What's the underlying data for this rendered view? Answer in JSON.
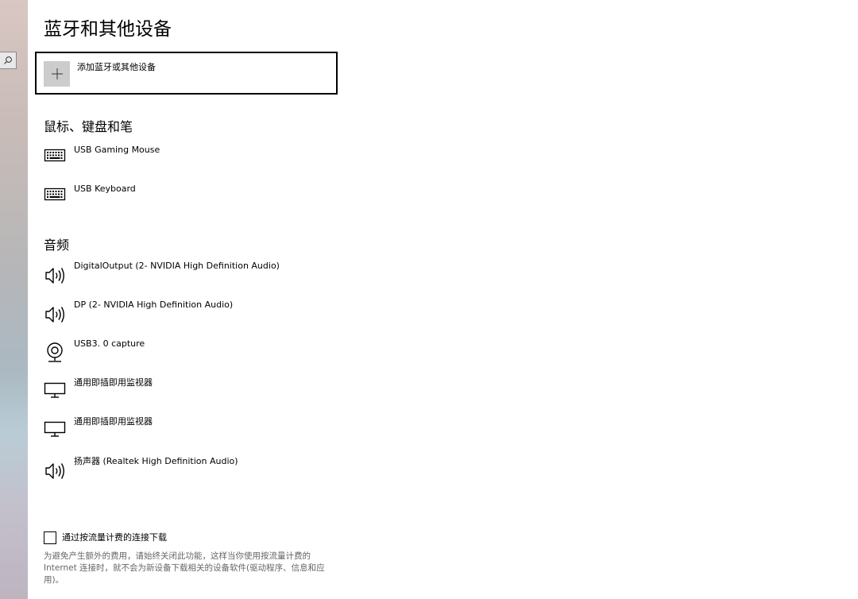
{
  "page": {
    "title": "蓝牙和其他设备"
  },
  "add_device": {
    "label": "添加蓝牙或其他设备",
    "icon": "plus-icon"
  },
  "sections": {
    "input": {
      "heading": "鼠标、键盘和笔",
      "devices": [
        {
          "name": "USB Gaming Mouse",
          "icon": "keyboard-icon"
        },
        {
          "name": "USB Keyboard",
          "icon": "keyboard-icon"
        }
      ]
    },
    "audio": {
      "heading": "音频",
      "devices": [
        {
          "name": "DigitalOutput (2- NVIDIA High Definition Audio)",
          "icon": "speaker-icon"
        },
        {
          "name": "DP (2- NVIDIA High Definition Audio)",
          "icon": "speaker-icon"
        },
        {
          "name": "USB3. 0 capture",
          "icon": "webcam-icon"
        },
        {
          "name": "通用即插即用监视器",
          "icon": "monitor-icon"
        },
        {
          "name": "通用即插即用监视器",
          "icon": "monitor-icon"
        },
        {
          "name": "扬声器 (Realtek High Definition Audio)",
          "icon": "speaker-icon"
        }
      ]
    }
  },
  "metered": {
    "label": "通过按流量计费的连接下载",
    "checked": false,
    "description": "为避免产生额外的费用，请始终关闭此功能，这样当你使用按流量计费的 Internet 连接时，就不会为新设备下载相关的设备软件(驱动程序、信息和应用)。"
  },
  "colors": {
    "accent_border": "#000000",
    "tile_gray": "#cccccc",
    "secondary_text": "#666666"
  }
}
